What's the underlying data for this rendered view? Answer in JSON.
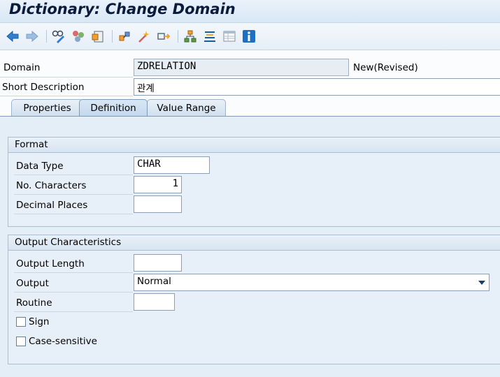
{
  "title": "Dictionary: Change Domain",
  "toolbar": {
    "icons": [
      "back-icon",
      "forward-icon",
      "display-change-icon",
      "other-object-icon",
      "activate-icon",
      "check-icon",
      "where-used-icon",
      "test-icon",
      "navigation-icon",
      "hierarchy-icon",
      "object-list-icon",
      "table-view-icon",
      "info-icon"
    ]
  },
  "header": {
    "domain_label": "Domain",
    "domain_value": "ZDRELATION",
    "domain_status": "New(Revised)",
    "short_desc_label": "Short Description",
    "short_desc_value": "관계"
  },
  "tabs": [
    "Properties",
    "Definition",
    "Value Range"
  ],
  "active_tab": "Definition",
  "format": {
    "title": "Format",
    "data_type_label": "Data Type",
    "data_type_value": "CHAR",
    "num_chars_label": "No. Characters",
    "num_chars_value": "1",
    "decimal_label": "Decimal Places",
    "decimal_value": ""
  },
  "output": {
    "title": "Output Characteristics",
    "length_label": "Output Length",
    "length_value": "",
    "output_label": "Output",
    "output_value": "Normal",
    "routine_label": "Routine",
    "routine_value": "",
    "sign_label": "Sign",
    "sign_checked": false,
    "case_label": "Case-sensitive",
    "case_checked": false
  },
  "colors": {
    "accent": "#1a5a9e",
    "title": "#0a1b3c"
  }
}
